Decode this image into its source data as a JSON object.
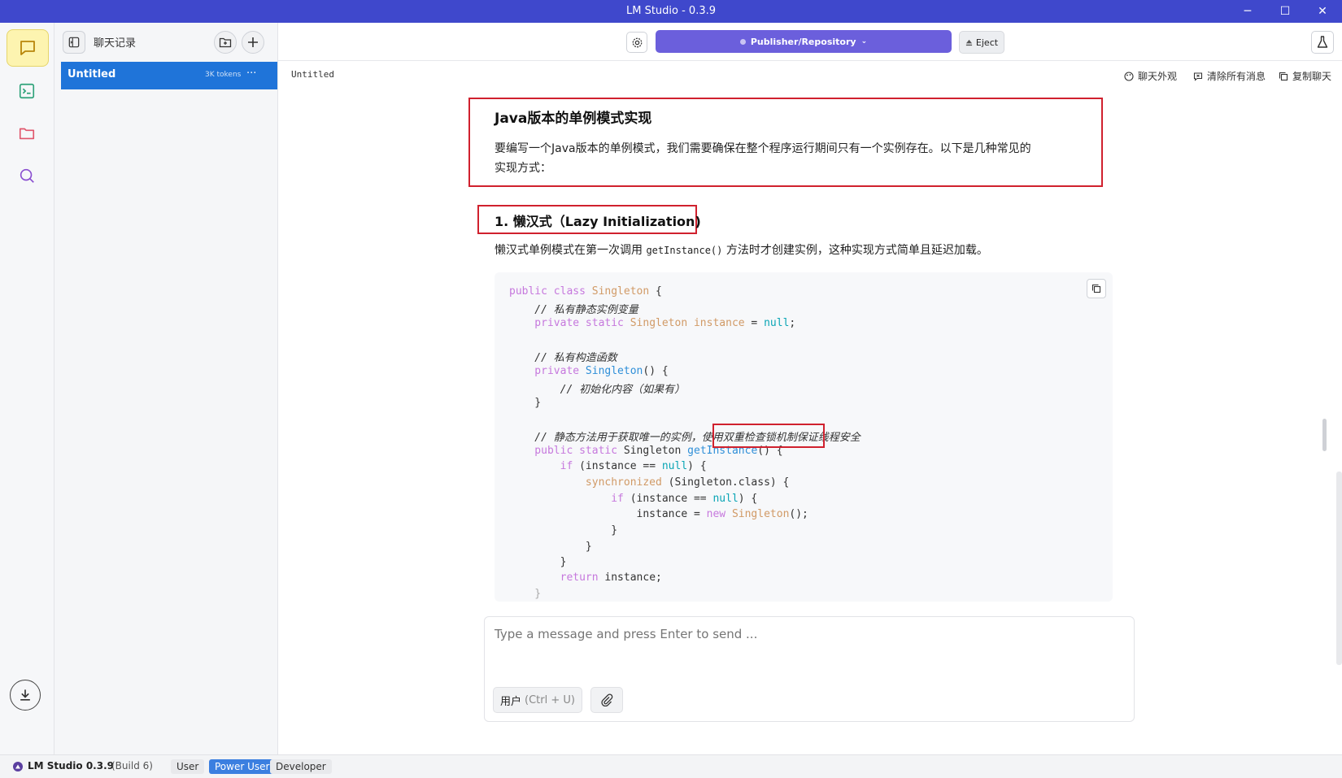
{
  "window": {
    "title": "LM Studio - 0.3.9",
    "minimize_glyph": "─",
    "maximize_glyph": "☐",
    "close_glyph": "✕"
  },
  "sidebar": {
    "title": "聊天记录",
    "chats": [
      {
        "title": "Untitled",
        "tokens": "3K tokens",
        "menu": "···"
      }
    ]
  },
  "topbar": {
    "model_label": "Publisher/Repository",
    "eject_label": "Eject"
  },
  "subbar": {
    "chat_title": "Untitled",
    "appearance_label": "聊天外观",
    "clear_label": "清除所有消息",
    "copy_label": "复制聊天"
  },
  "content": {
    "heading": "Java版本的单例模式实现",
    "intro_line1": "要编写一个Java版本的单例模式，我们需要确保在整个程序运行期间只有一个实例存在。以下是几种常见的",
    "intro_line2": "实现方式：",
    "section_title": "1. 懒汉式（Lazy Initialization)",
    "section_desc_pre": "懒汉式单例模式在第一次调用 ",
    "section_desc_code": "getInstance()",
    "section_desc_post": " 方法时才创建实例，这种实现方式简单且延迟加载。"
  },
  "code": {
    "l1_kw": "public class ",
    "l1_ty": "Singleton",
    "l1_rest": " {",
    "l2_cm": "    // 私有静态实例变量",
    "l3_kw": "    private static ",
    "l3_ty": "Singleton instance",
    "l3_eq": " = ",
    "l3_lit": "null",
    "l3_end": ";",
    "l5_cm": "    // 私有构造函数",
    "l6_kw": "    private ",
    "l6_fn": "Singleton",
    "l6_rest": "() {",
    "l7_cm": "        // 初始化内容（如果有）",
    "l8": "    }",
    "l10_cm": "    // 静态方法用于获取唯一的实例，使用双重检查锁机制保证线程安全",
    "l11_kw": "    public static ",
    "l11_mid": "Singleton ",
    "l11_fn": "getInstance",
    "l11_rest": "() {",
    "l12_kw": "        if",
    "l12_mid": " (instance == ",
    "l12_lit": "null",
    "l12_end": ") {",
    "l13_kw": "            synchronized",
    "l13_rest": " (Singleton.class) {",
    "l14_kw": "                if",
    "l14_mid": " (instance == ",
    "l14_lit": "null",
    "l14_end": ") {",
    "l15_pre": "                    instance = ",
    "l15_kw": "new ",
    "l15_ty": "Singleton",
    "l15_end": "();",
    "l16": "                }",
    "l17": "            }",
    "l18": "        }",
    "l19_kw": "        return",
    "l19_rest": " instance;",
    "l20": "    }"
  },
  "composer": {
    "placeholder": "Type a message and press Enter to send ...",
    "role_label": "用户",
    "role_shortcut": "(Ctrl + U)"
  },
  "statusbar": {
    "app_name": "LM Studio 0.3.9",
    "build": "(Build 6)",
    "modes": [
      "User",
      "Power User",
      "Developer"
    ],
    "active_mode": "Power User"
  },
  "colors": {
    "titlebar": "#3f48cc",
    "model_button": "#6b5fdc",
    "selected_chat": "#1f74d9",
    "active_mode": "#3b7fe0",
    "annotation_red": "#d0212e"
  }
}
